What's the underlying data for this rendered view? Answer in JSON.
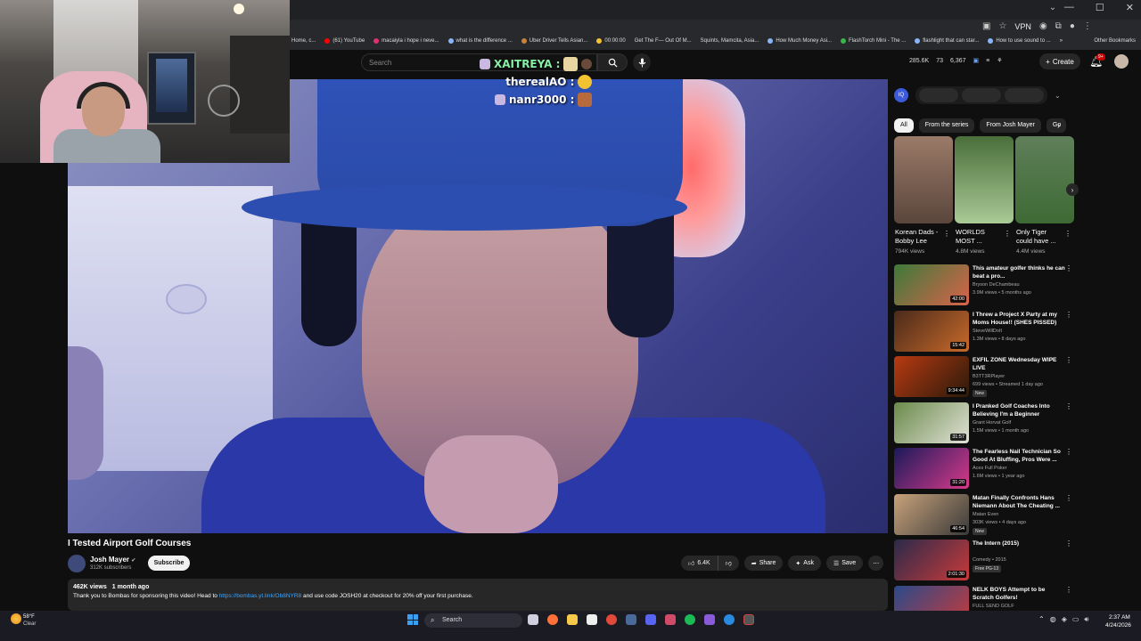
{
  "browser": {
    "vpn_label": "VPN",
    "bookmarks": [
      "e Home, c...",
      "(61) YouTube",
      "macaiyla i hope i neve...",
      "what is the difference ...",
      "Uber Driver Tells Asian...",
      "00:00:00",
      "Get The F— Out Of M...",
      "Squints, Mamcita, Asia...",
      "How Much Money Asi...",
      "FlashTorch Mini - The ...",
      "flashlight that can star...",
      "How to use sound to ..."
    ],
    "other_bookmarks": "Other Bookmarks"
  },
  "header": {
    "search_placeholder": "Search",
    "stats": [
      "285.6K",
      "73",
      "6,367"
    ],
    "create_label": "Create",
    "notif_count": "9+"
  },
  "chat": [
    {
      "name": "XAITREYA :",
      "emote_color": "#e8d6a0"
    },
    {
      "name": "therealAO :",
      "emote_color": "#f2c230"
    },
    {
      "name": "nanr3000 :",
      "emote_color": "#b76a3c"
    }
  ],
  "video": {
    "title": "I Tested Airport Golf Courses",
    "channel": "Josh Mayer",
    "subscribers": "312K subscribers",
    "subscribe_label": "Subscribe",
    "likes": "6.4K",
    "share_label": "Share",
    "ask_label": "Ask",
    "save_label": "Save",
    "views": "462K views",
    "age": "1 month ago",
    "desc_before": "Thank you to Bombas for sponsoring this video! Head to ",
    "desc_link": "https://bombas.yt.link/Ob8NYR8",
    "desc_after": " and use code JOSH20 at checkout for 20% off your first purchase."
  },
  "sidebar": {
    "chips": [
      "All",
      "From the series",
      "From Josh Mayer",
      "Go"
    ],
    "shorts": [
      {
        "title": "Korean Dads - Bobby Lee",
        "views": "794K views"
      },
      {
        "title": "WORLDS MOST ...",
        "views": "4.8M views"
      },
      {
        "title": "Only Tiger could have ...",
        "views": "4.4M views"
      }
    ],
    "recs": [
      {
        "title": "This amateur golfer thinks he can beat a pro...",
        "channel": "Bryson DeChambeau",
        "meta": "3.9M views • 5 months ago",
        "duration": "42:00",
        "badge": "",
        "c1": "#3d7a3a",
        "c2": "#d9634a"
      },
      {
        "title": "I Threw a Project X Party at my Moms House!! (SHES PISSED)",
        "channel": "SteveWillDoIt",
        "meta": "1.3M views • 8 days ago",
        "duration": "15:42",
        "badge": "",
        "c1": "#4a2a1a",
        "c2": "#c86a2a"
      },
      {
        "title": "EXFIL ZONE Wednesday WIPE LIVE",
        "channel": "B3TT3RPlayer",
        "meta": "699 views • Streamed 1 day ago",
        "duration": "9:34:44",
        "badge": "New",
        "c1": "#b83a12",
        "c2": "#2a1a0a"
      },
      {
        "title": "I Pranked Golf Coaches Into Believing I'm a Beginner",
        "channel": "Grant Horvat Golf",
        "meta": "1.5M views • 1 month ago",
        "duration": "31:57",
        "badge": "",
        "c1": "#6a8a4a",
        "c2": "#e2e2d8"
      },
      {
        "title": "The Fearless Nail Technician So Good At Bluffing, Pros Were ...",
        "channel": "Aces Full Poker",
        "meta": "1.6M views • 1 year ago",
        "duration": "31:20",
        "badge": "",
        "c1": "#1a1a5a",
        "c2": "#d83a8a"
      },
      {
        "title": "Matan Finally Confronts Hans Niemann About The Cheating ...",
        "channel": "Matan Even",
        "meta": "303K views • 4 days ago",
        "duration": "46:54",
        "badge": "New",
        "c1": "#c8a27a",
        "c2": "#3a3a3a"
      },
      {
        "title": "The Intern (2015)",
        "channel": "Comedy • 2015",
        "meta": "",
        "duration": "2:01:30",
        "badge": "Free PG-13",
        "c1": "#2a2a4a",
        "c2": "#c83a3a"
      },
      {
        "title": "NELK BOYS Attempt to be Scratch Golfers!",
        "channel": "FULL SEND GOLF",
        "meta": "",
        "duration": "",
        "badge": "",
        "c1": "#2a4a8a",
        "c2": "#c83a3a"
      }
    ]
  },
  "taskbar": {
    "temp": "58°F",
    "condition": "Clear",
    "search_label": "Search",
    "time": "2:37 AM",
    "date": "4/24/2026"
  }
}
